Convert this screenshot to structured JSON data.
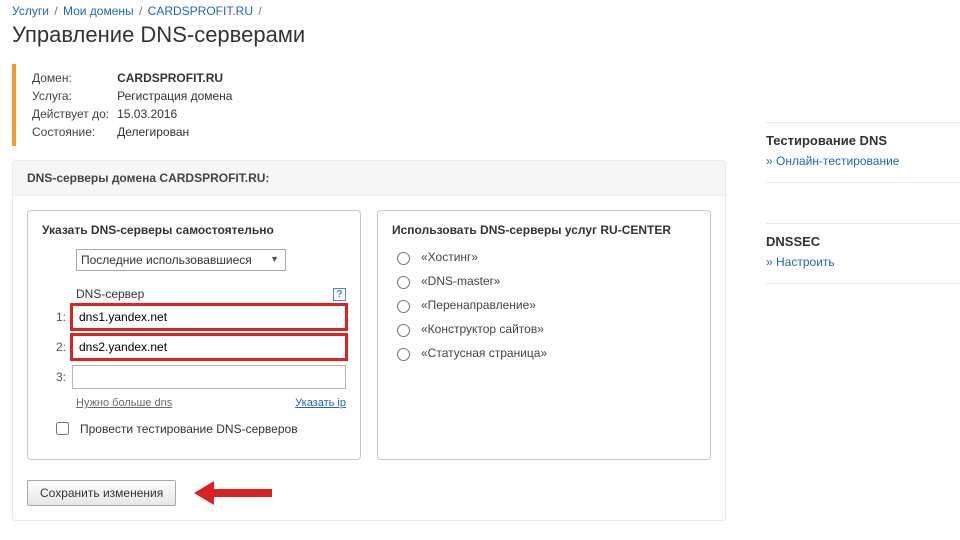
{
  "breadcrumb": {
    "services": "Услуги",
    "mydomains": "Мои домены",
    "domain": "CARDSPROFIT.RU"
  },
  "page_title": "Управление DNS-серверами",
  "info": {
    "domain_lbl": "Домен:",
    "domain": "CARDSPROFIT.RU",
    "service_lbl": "Услуга:",
    "service": "Регистрация домена",
    "valid_lbl": "Действует до:",
    "valid": "15.03.2016",
    "state_lbl": "Состояние:",
    "state": "Делегирован"
  },
  "panel_title": "DNS-серверы домена CARDSPROFIT.RU:",
  "left": {
    "title": "Указать DNS-серверы самостоятельно",
    "select_label": "Последние использовавшиеся",
    "field_label": "DNS-сервер",
    "rows": [
      {
        "n": "1:",
        "v": "dns1.yandex.net"
      },
      {
        "n": "2:",
        "v": "dns2.yandex.net"
      },
      {
        "n": "3:",
        "v": ""
      }
    ],
    "more": "Нужно больше dns",
    "ip": "Указать ip",
    "test": "Провести тестирование DNS-серверов"
  },
  "right": {
    "title": "Использовать DNS-серверы услуг RU-CENTER",
    "options": [
      "«Хостинг»",
      "«DNS-master»",
      "«Перенаправление»",
      "«Конструктор сайтов»",
      "«Статусная страница»"
    ]
  },
  "save_btn": "Сохранить изменения",
  "side1": {
    "title": "Тестирование DNS",
    "link": "Онлайн-тестирование"
  },
  "side2": {
    "title": "DNSSEC",
    "link": "Настроить"
  }
}
